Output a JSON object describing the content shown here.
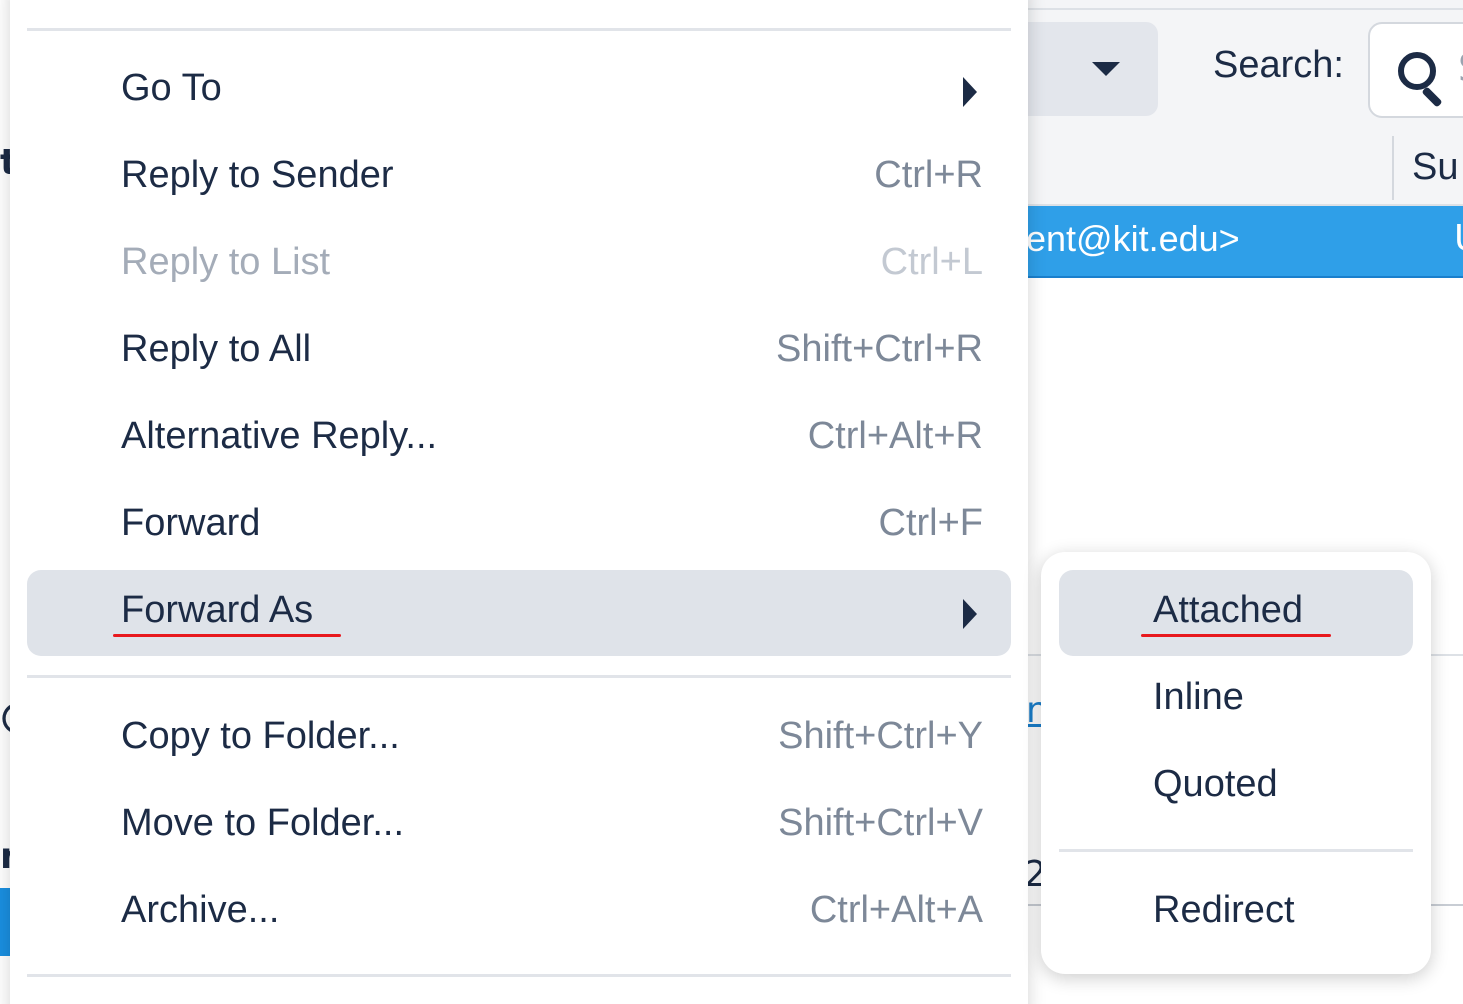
{
  "background": {
    "search_label": "Search:",
    "search_placeholder_fragment": "S",
    "column_subject_fragment": "Su",
    "selected_sender_fragment": "ent@kit.edu>",
    "selected_subject_fragment": "U",
    "left_fragments": [
      "t",
      "@",
      "n"
    ],
    "link_fragment": "n",
    "number_fragment": "2"
  },
  "context_menu": {
    "items": [
      {
        "label": "Go To",
        "shortcut": "",
        "submenu": true
      },
      {
        "label": "Reply to Sender",
        "shortcut": "Ctrl+R"
      },
      {
        "label": "Reply to List",
        "shortcut": "Ctrl+L",
        "disabled": true
      },
      {
        "label": "Reply to All",
        "shortcut": "Shift+Ctrl+R"
      },
      {
        "label": "Alternative Reply...",
        "shortcut": "Ctrl+Alt+R"
      },
      {
        "label": "Forward",
        "shortcut": "Ctrl+F"
      },
      {
        "label": "Forward As",
        "shortcut": "",
        "submenu": true,
        "highlighted": true
      },
      {
        "label": "Copy to Folder...",
        "shortcut": "Shift+Ctrl+Y"
      },
      {
        "label": "Move to Folder...",
        "shortcut": "Shift+Ctrl+V"
      },
      {
        "label": "Archive...",
        "shortcut": "Ctrl+Alt+A"
      }
    ]
  },
  "forward_as_submenu": {
    "items": [
      {
        "label": "Attached",
        "highlighted": true
      },
      {
        "label": "Inline"
      },
      {
        "label": "Quoted"
      },
      {
        "label": "Redirect"
      }
    ]
  },
  "colors": {
    "accent": "#2f9fe8",
    "hover": "#dfe3e9",
    "annotation_underline": "#e8191e",
    "text": "#1c2b45",
    "shortcut_text": "#7d8898"
  }
}
